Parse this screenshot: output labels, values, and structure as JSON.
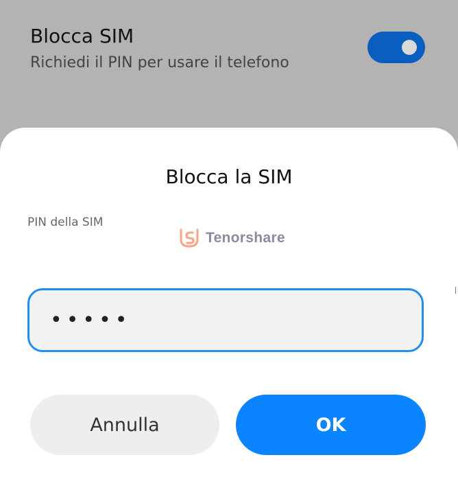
{
  "setting": {
    "title": "Blocca SIM",
    "subtitle": "Richiedi il PIN per usare il telefono",
    "toggle_on": true,
    "toggle_color": "#0a5ebf"
  },
  "dialog": {
    "title": "Blocca la SIM",
    "field_label": "PIN della SIM",
    "pin_value": "•••••",
    "cancel_label": "Annulla",
    "ok_label": "OK"
  },
  "watermark": {
    "text": "Tenorshare",
    "icon": "tenorshare-logo-icon"
  },
  "colors": {
    "accent": "#0a84ff",
    "input_border": "#1f8ef0",
    "overlay": "#b3b3b3"
  }
}
